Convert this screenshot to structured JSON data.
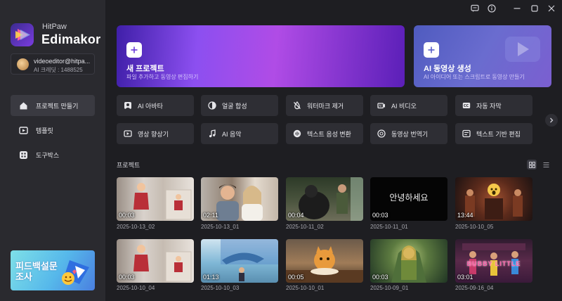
{
  "brand": {
    "small": "HitPaw",
    "name": "Edimakor"
  },
  "account": {
    "email": "videoeditor@hitpa...",
    "credit": "AI 크레딧 : 1488525"
  },
  "nav": [
    {
      "label": "프로젝트 만들기",
      "icon": "home-icon",
      "active": true
    },
    {
      "label": "템플릿",
      "icon": "template-icon",
      "active": false
    },
    {
      "label": "도구박스",
      "icon": "toolbox-icon",
      "active": false
    }
  ],
  "promo": {
    "text": "피드백설문조사"
  },
  "titlebar": {
    "icons": [
      "message-icon",
      "info-icon",
      "minimize-icon",
      "maximize-icon",
      "close-icon"
    ]
  },
  "cards": {
    "new_project": {
      "title": "새 프로젝트",
      "subtitle": "파일 추가하고 동영상 편집하기"
    },
    "ai_video": {
      "title": "AI 동영상 생성",
      "subtitle": "AI 아이디어 또는 스크립트로 동영상 만들기"
    }
  },
  "tools": [
    {
      "label": "AI 아바타",
      "icon": "avatar-icon"
    },
    {
      "label": "얼굴 합성",
      "icon": "face-swap-icon"
    },
    {
      "label": "워터마크 제거",
      "icon": "watermark-remove-icon"
    },
    {
      "label": "AI 비디오",
      "icon": "ai-video-icon"
    },
    {
      "label": "자동 자막",
      "icon": "caption-icon"
    },
    {
      "label": "영상 향상기",
      "icon": "enhance-icon"
    },
    {
      "label": "AI 음악",
      "icon": "music-icon"
    },
    {
      "label": "텍스트 음성 변환",
      "icon": "text-to-speech-icon"
    },
    {
      "label": "동영상 번역기",
      "icon": "translate-icon"
    },
    {
      "label": "텍스트 기반 편집",
      "icon": "text-edit-icon"
    }
  ],
  "projects": {
    "title": "프로젝트",
    "items": [
      {
        "duration": "00:03",
        "date": "2025-10-13_02"
      },
      {
        "duration": "02:11",
        "date": "2025-10-13_01"
      },
      {
        "duration": "00:04",
        "date": "2025-10-11_02"
      },
      {
        "duration": "00:03",
        "date": "2025-10-11_01",
        "overlay": "안녕하세요"
      },
      {
        "duration": "13:44",
        "date": "2025-10-10_05"
      },
      {
        "duration": "00:03",
        "date": "2025-10-10_04"
      },
      {
        "duration": "01:13",
        "date": "2025-10-10_03"
      },
      {
        "duration": "00:05",
        "date": "2025-10-10_01"
      },
      {
        "duration": "00:03",
        "date": "2025-10-09_01"
      },
      {
        "duration": "03:01",
        "date": "2025-09-16_04",
        "overlay": "BUBBY LITTLE"
      }
    ]
  },
  "colors": {
    "sidebar": "#2a2a2f",
    "background": "#1e1e22",
    "tool_bg": "#2e2e34",
    "accent": "#8c4ff0"
  }
}
